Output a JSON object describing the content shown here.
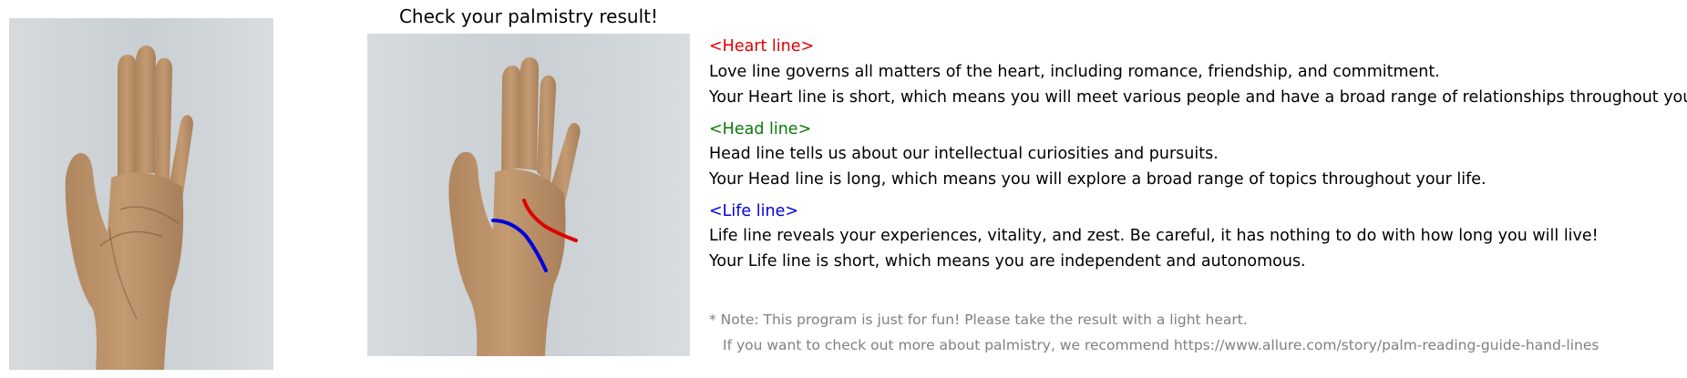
{
  "result": {
    "title": "Check your palmistry result!"
  },
  "lines": {
    "heart": {
      "header": "<Heart line>",
      "description": "Love line governs all matters of the heart, including romance, friendship, and commitment.",
      "reading": "Your Heart line is short, which means you will meet various people and have a broad range of relationships throughout your life.",
      "color": "#e00000"
    },
    "head": {
      "header": "<Head line>",
      "description": "Head line tells us about our intellectual curiosities and pursuits.",
      "reading": "Your Head line is long, which means you will explore a broad range of topics throughout your life.",
      "color": "#0a7a0a"
    },
    "life": {
      "header": "<Life line>",
      "description": "Life line reveals your experiences, vitality, and zest. Be careful, it has nothing to do with how long you will live!",
      "reading": "Your Life line is short, which means you are independent and autonomous.",
      "color": "#0000dd"
    }
  },
  "note": {
    "line1": "* Note: This program is just for fun! Please take the result with a light heart.",
    "line2": "If you want to check out more about palmistry, we recommend https://www.allure.com/story/palm-reading-guide-hand-lines",
    "color": "#808080"
  },
  "images": {
    "input": "hand-photo",
    "result": "hand-photo-with-palm-lines"
  }
}
